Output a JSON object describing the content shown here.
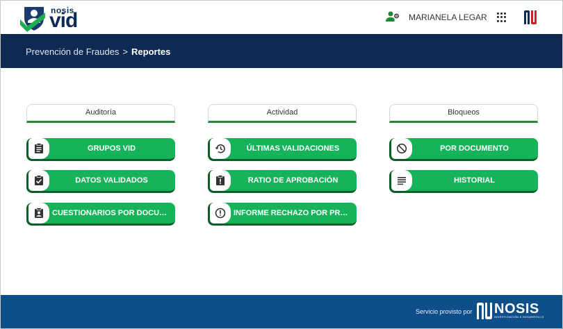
{
  "header": {
    "brand_top": "nosis",
    "brand_main": "vid",
    "user_name": "MARIANELA LEGAR"
  },
  "breadcrumb": {
    "parent": "Prevención de Fraudes",
    "separator": ">",
    "current": "Reportes"
  },
  "columns": [
    {
      "title": "Auditoría",
      "items": [
        {
          "label": "GRUPOS VID",
          "icon": "clipboard-list-icon"
        },
        {
          "label": "DATOS VALIDADOS",
          "icon": "clipboard-check-icon"
        },
        {
          "label": "CUESTIONARIOS POR DOCUMENTO",
          "icon": "contact-card-icon"
        }
      ]
    },
    {
      "title": "Actividad",
      "items": [
        {
          "label": "ÚLTIMAS VALIDACIONES",
          "icon": "history-icon"
        },
        {
          "label": "RATIO DE APROBACIÓN",
          "icon": "clipboard-alert-icon"
        },
        {
          "label": "INFORME RECHAZO POR PREGUNTA",
          "icon": "alert-circle-icon"
        }
      ]
    },
    {
      "title": "Bloqueos",
      "items": [
        {
          "label": "POR DOCUMENTO",
          "icon": "block-icon"
        },
        {
          "label": "HISTORIAL",
          "icon": "document-lines-icon"
        }
      ]
    }
  ],
  "footer": {
    "provided_by": "Servicio provisto por",
    "brand": "NOSIS",
    "brand_sub": "INVESTIGACIÓN & DESARROLLO"
  },
  "colors": {
    "navy": "#0e2a52",
    "footer_blue": "#0e4f8b",
    "green": "#17b35b",
    "dark_green": "#0b5e26"
  }
}
